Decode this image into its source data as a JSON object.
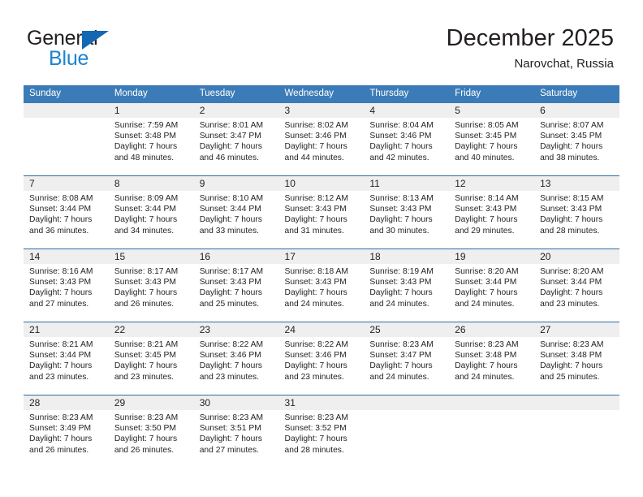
{
  "brand": {
    "name_top": "General",
    "name_bottom": "Blue"
  },
  "header": {
    "month_title": "December 2025",
    "location": "Narovchat, Russia"
  },
  "colors": {
    "header_blue": "#3b7cb8",
    "separator_blue": "#2e6da4",
    "daynum_bg": "#efefef",
    "brand_blue": "#1b84d0",
    "text": "#231f20"
  },
  "weekday_headers": [
    "Sunday",
    "Monday",
    "Tuesday",
    "Wednesday",
    "Thursday",
    "Friday",
    "Saturday"
  ],
  "weeks": [
    [
      {
        "day": "",
        "sunrise": "",
        "sunset": "",
        "daylight_1": "",
        "daylight_2": ""
      },
      {
        "day": "1",
        "sunrise": "Sunrise: 7:59 AM",
        "sunset": "Sunset: 3:48 PM",
        "daylight_1": "Daylight: 7 hours",
        "daylight_2": "and 48 minutes."
      },
      {
        "day": "2",
        "sunrise": "Sunrise: 8:01 AM",
        "sunset": "Sunset: 3:47 PM",
        "daylight_1": "Daylight: 7 hours",
        "daylight_2": "and 46 minutes."
      },
      {
        "day": "3",
        "sunrise": "Sunrise: 8:02 AM",
        "sunset": "Sunset: 3:46 PM",
        "daylight_1": "Daylight: 7 hours",
        "daylight_2": "and 44 minutes."
      },
      {
        "day": "4",
        "sunrise": "Sunrise: 8:04 AM",
        "sunset": "Sunset: 3:46 PM",
        "daylight_1": "Daylight: 7 hours",
        "daylight_2": "and 42 minutes."
      },
      {
        "day": "5",
        "sunrise": "Sunrise: 8:05 AM",
        "sunset": "Sunset: 3:45 PM",
        "daylight_1": "Daylight: 7 hours",
        "daylight_2": "and 40 minutes."
      },
      {
        "day": "6",
        "sunrise": "Sunrise: 8:07 AM",
        "sunset": "Sunset: 3:45 PM",
        "daylight_1": "Daylight: 7 hours",
        "daylight_2": "and 38 minutes."
      }
    ],
    [
      {
        "day": "7",
        "sunrise": "Sunrise: 8:08 AM",
        "sunset": "Sunset: 3:44 PM",
        "daylight_1": "Daylight: 7 hours",
        "daylight_2": "and 36 minutes."
      },
      {
        "day": "8",
        "sunrise": "Sunrise: 8:09 AM",
        "sunset": "Sunset: 3:44 PM",
        "daylight_1": "Daylight: 7 hours",
        "daylight_2": "and 34 minutes."
      },
      {
        "day": "9",
        "sunrise": "Sunrise: 8:10 AM",
        "sunset": "Sunset: 3:44 PM",
        "daylight_1": "Daylight: 7 hours",
        "daylight_2": "and 33 minutes."
      },
      {
        "day": "10",
        "sunrise": "Sunrise: 8:12 AM",
        "sunset": "Sunset: 3:43 PM",
        "daylight_1": "Daylight: 7 hours",
        "daylight_2": "and 31 minutes."
      },
      {
        "day": "11",
        "sunrise": "Sunrise: 8:13 AM",
        "sunset": "Sunset: 3:43 PM",
        "daylight_1": "Daylight: 7 hours",
        "daylight_2": "and 30 minutes."
      },
      {
        "day": "12",
        "sunrise": "Sunrise: 8:14 AM",
        "sunset": "Sunset: 3:43 PM",
        "daylight_1": "Daylight: 7 hours",
        "daylight_2": "and 29 minutes."
      },
      {
        "day": "13",
        "sunrise": "Sunrise: 8:15 AM",
        "sunset": "Sunset: 3:43 PM",
        "daylight_1": "Daylight: 7 hours",
        "daylight_2": "and 28 minutes."
      }
    ],
    [
      {
        "day": "14",
        "sunrise": "Sunrise: 8:16 AM",
        "sunset": "Sunset: 3:43 PM",
        "daylight_1": "Daylight: 7 hours",
        "daylight_2": "and 27 minutes."
      },
      {
        "day": "15",
        "sunrise": "Sunrise: 8:17 AM",
        "sunset": "Sunset: 3:43 PM",
        "daylight_1": "Daylight: 7 hours",
        "daylight_2": "and 26 minutes."
      },
      {
        "day": "16",
        "sunrise": "Sunrise: 8:17 AM",
        "sunset": "Sunset: 3:43 PM",
        "daylight_1": "Daylight: 7 hours",
        "daylight_2": "and 25 minutes."
      },
      {
        "day": "17",
        "sunrise": "Sunrise: 8:18 AM",
        "sunset": "Sunset: 3:43 PM",
        "daylight_1": "Daylight: 7 hours",
        "daylight_2": "and 24 minutes."
      },
      {
        "day": "18",
        "sunrise": "Sunrise: 8:19 AM",
        "sunset": "Sunset: 3:43 PM",
        "daylight_1": "Daylight: 7 hours",
        "daylight_2": "and 24 minutes."
      },
      {
        "day": "19",
        "sunrise": "Sunrise: 8:20 AM",
        "sunset": "Sunset: 3:44 PM",
        "daylight_1": "Daylight: 7 hours",
        "daylight_2": "and 24 minutes."
      },
      {
        "day": "20",
        "sunrise": "Sunrise: 8:20 AM",
        "sunset": "Sunset: 3:44 PM",
        "daylight_1": "Daylight: 7 hours",
        "daylight_2": "and 23 minutes."
      }
    ],
    [
      {
        "day": "21",
        "sunrise": "Sunrise: 8:21 AM",
        "sunset": "Sunset: 3:44 PM",
        "daylight_1": "Daylight: 7 hours",
        "daylight_2": "and 23 minutes."
      },
      {
        "day": "22",
        "sunrise": "Sunrise: 8:21 AM",
        "sunset": "Sunset: 3:45 PM",
        "daylight_1": "Daylight: 7 hours",
        "daylight_2": "and 23 minutes."
      },
      {
        "day": "23",
        "sunrise": "Sunrise: 8:22 AM",
        "sunset": "Sunset: 3:46 PM",
        "daylight_1": "Daylight: 7 hours",
        "daylight_2": "and 23 minutes."
      },
      {
        "day": "24",
        "sunrise": "Sunrise: 8:22 AM",
        "sunset": "Sunset: 3:46 PM",
        "daylight_1": "Daylight: 7 hours",
        "daylight_2": "and 23 minutes."
      },
      {
        "day": "25",
        "sunrise": "Sunrise: 8:23 AM",
        "sunset": "Sunset: 3:47 PM",
        "daylight_1": "Daylight: 7 hours",
        "daylight_2": "and 24 minutes."
      },
      {
        "day": "26",
        "sunrise": "Sunrise: 8:23 AM",
        "sunset": "Sunset: 3:48 PM",
        "daylight_1": "Daylight: 7 hours",
        "daylight_2": "and 24 minutes."
      },
      {
        "day": "27",
        "sunrise": "Sunrise: 8:23 AM",
        "sunset": "Sunset: 3:48 PM",
        "daylight_1": "Daylight: 7 hours",
        "daylight_2": "and 25 minutes."
      }
    ],
    [
      {
        "day": "28",
        "sunrise": "Sunrise: 8:23 AM",
        "sunset": "Sunset: 3:49 PM",
        "daylight_1": "Daylight: 7 hours",
        "daylight_2": "and 26 minutes."
      },
      {
        "day": "29",
        "sunrise": "Sunrise: 8:23 AM",
        "sunset": "Sunset: 3:50 PM",
        "daylight_1": "Daylight: 7 hours",
        "daylight_2": "and 26 minutes."
      },
      {
        "day": "30",
        "sunrise": "Sunrise: 8:23 AM",
        "sunset": "Sunset: 3:51 PM",
        "daylight_1": "Daylight: 7 hours",
        "daylight_2": "and 27 minutes."
      },
      {
        "day": "31",
        "sunrise": "Sunrise: 8:23 AM",
        "sunset": "Sunset: 3:52 PM",
        "daylight_1": "Daylight: 7 hours",
        "daylight_2": "and 28 minutes."
      },
      {
        "day": "",
        "sunrise": "",
        "sunset": "",
        "daylight_1": "",
        "daylight_2": ""
      },
      {
        "day": "",
        "sunrise": "",
        "sunset": "",
        "daylight_1": "",
        "daylight_2": ""
      },
      {
        "day": "",
        "sunrise": "",
        "sunset": "",
        "daylight_1": "",
        "daylight_2": ""
      }
    ]
  ]
}
